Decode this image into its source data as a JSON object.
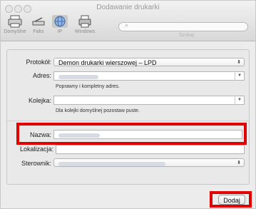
{
  "window": {
    "title": "Dodawanie drukarki"
  },
  "toolbar": {
    "items": [
      {
        "label": "Domyślne",
        "icon": "printer-default-icon"
      },
      {
        "label": "Faks",
        "icon": "fax-icon"
      },
      {
        "label": "IP",
        "icon": "globe-ip-icon"
      },
      {
        "label": "Windows",
        "icon": "windows-printer-icon"
      }
    ],
    "search": {
      "placeholder": "",
      "label": "Szukaj"
    }
  },
  "form": {
    "protocol": {
      "label": "Protokół:",
      "value": "Demon drukarki wierszowej – LPD"
    },
    "address": {
      "label": "Adres:",
      "value": "",
      "hint": "Poprawny i kompletny adres."
    },
    "queue": {
      "label": "Kolejka:",
      "value": "",
      "hint": "Dla kolejki domyślnej pozostaw puste."
    },
    "name": {
      "label": "Nazwa:",
      "value": ""
    },
    "location": {
      "label": "Lokalizacja:",
      "value": ""
    },
    "driver": {
      "label": "Sterownik:",
      "value": ""
    }
  },
  "actions": {
    "add_label": "Dodaj"
  },
  "colors": {
    "highlight": "#e10000"
  }
}
